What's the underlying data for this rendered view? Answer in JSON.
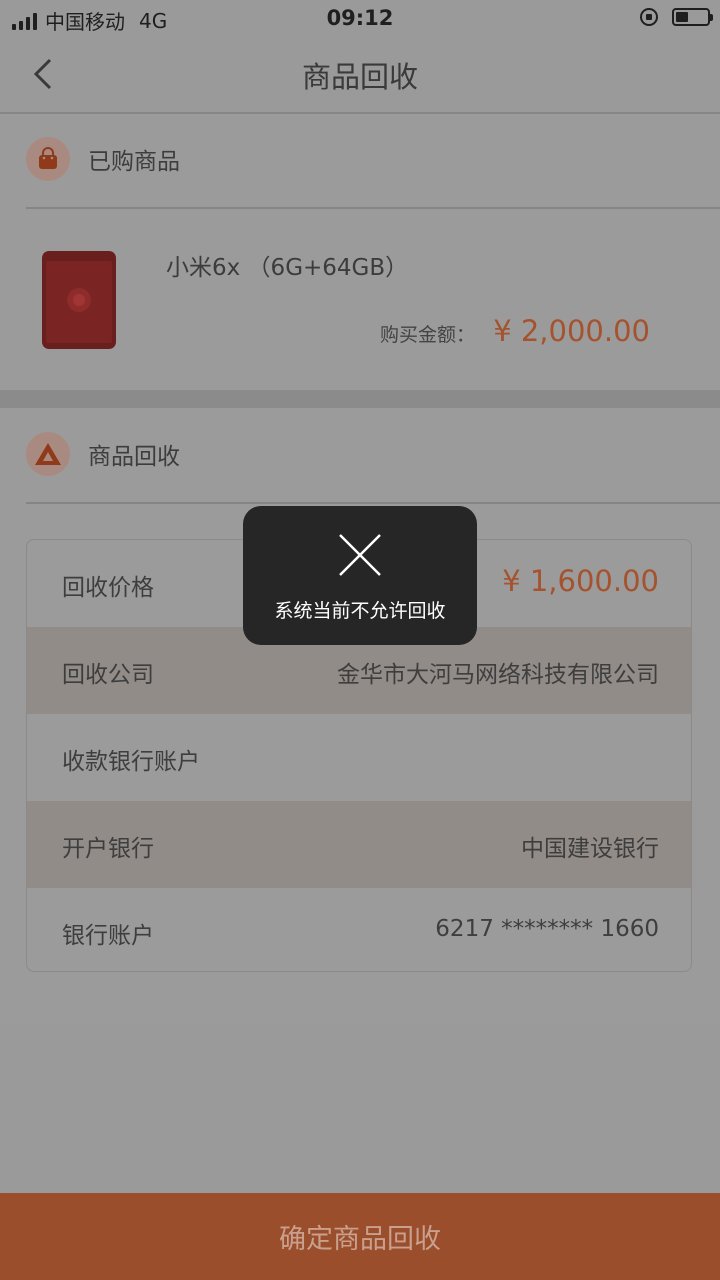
{
  "status_bar": {
    "carrier": "中国移动",
    "network": "4G",
    "time": "09:12"
  },
  "nav": {
    "title": "商品回收"
  },
  "purchased_section": {
    "title": "已购商品",
    "product_name": "小米6x （6G+64GB）",
    "price_label": "购买金额：",
    "price_value": "¥ 2,000.00"
  },
  "recycle_section": {
    "title": "商品回收",
    "rows": [
      {
        "label": "回收价格",
        "value": "¥ 1,600.00"
      },
      {
        "label": "回收公司",
        "value": "金华市大河马网络科技有限公司"
      },
      {
        "label": "收款银行账户",
        "value": ""
      },
      {
        "label": "开户银行",
        "value": "中国建设银行"
      },
      {
        "label": "银行账户",
        "value": "6217 ******** 1660"
      }
    ]
  },
  "toast": {
    "icon": "close-icon",
    "message": "系统当前不允许回收"
  },
  "bottom": {
    "confirm_label": "确定商品回收"
  },
  "colors": {
    "accent": "#a4532e",
    "button": "#9a4e2c",
    "toast_bg": "#262626"
  }
}
